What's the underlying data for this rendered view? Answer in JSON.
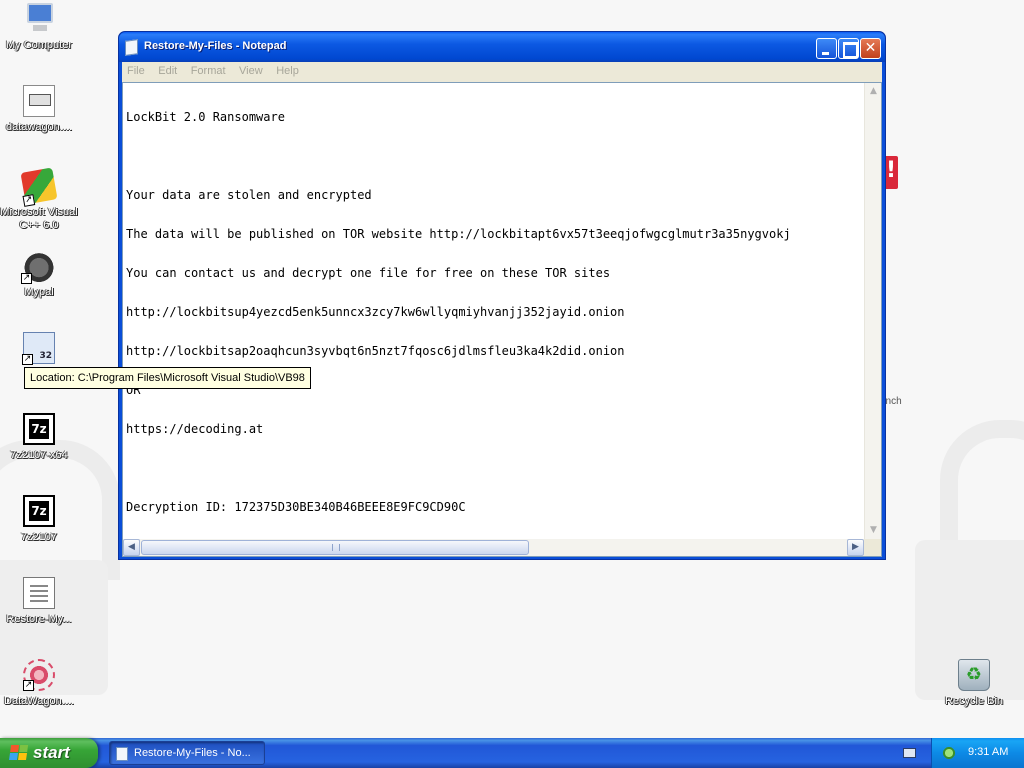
{
  "desktop": {
    "icons": [
      {
        "label": "My Computer",
        "icon": "my-computer-icon"
      },
      {
        "label": "datawagon....",
        "icon": "document-file-icon"
      },
      {
        "label": "Microsoft Visual C++ 6.0",
        "icon": "visual-cpp-icon"
      },
      {
        "label": "Mypal",
        "icon": "mypal-browser-icon"
      },
      {
        "label": "Micr...",
        "icon": "visual-basic-icon"
      },
      {
        "label": "7z2107-x64",
        "icon": "7zip-icon"
      },
      {
        "label": "7z2107",
        "icon": "7zip-icon"
      },
      {
        "label": "Restore-My...",
        "icon": "text-document-icon"
      },
      {
        "label": "DataWagon....",
        "icon": "datawagon-icon"
      },
      {
        "label": "Recycle Bin",
        "icon": "recycle-bin-icon"
      }
    ],
    "wallpaper_text": "unch",
    "tooltip": "Location: C:\\Program Files\\Microsoft Visual Studio\\VB98"
  },
  "window": {
    "title": "Restore-My-Files - Notepad",
    "menu": [
      "File",
      "Edit",
      "Format",
      "View",
      "Help"
    ],
    "content_lines": [
      "LockBit 2.0 Ransomware",
      "",
      "Your data are stolen and encrypted",
      "The data will be published on TOR website http://lockbitapt6vx57t3eeqjofwgcglmutr3a35nygvokj",
      "You can contact us and decrypt one file for free on these TOR sites",
      "http://lockbitsup4yezcd5enk5unncx3zcy7kw6wllyqmiyhvanjj352jayid.onion",
      "http://lockbitsap2oaqhcun3syvbqt6n5nzt7fqosc6jdlmsfleu3ka4k2did.onion",
      "OR",
      "https://decoding.at",
      "",
      "Decryption ID: 172375D30BE340B46BEEE8E9FC9CD90C"
    ],
    "scroll": {
      "horizontal_thumb_fraction": 0.55
    }
  },
  "taskbar": {
    "start_label": "start",
    "task_button_label": "Restore-My-Files - No...",
    "clock": "9:31 AM"
  },
  "colors": {
    "titlebar": "#0a5cf5",
    "taskbar": "#2663e0",
    "start_button": "#37a537",
    "tooltip_bg": "#ffffe1",
    "alert": "#d9283a"
  }
}
